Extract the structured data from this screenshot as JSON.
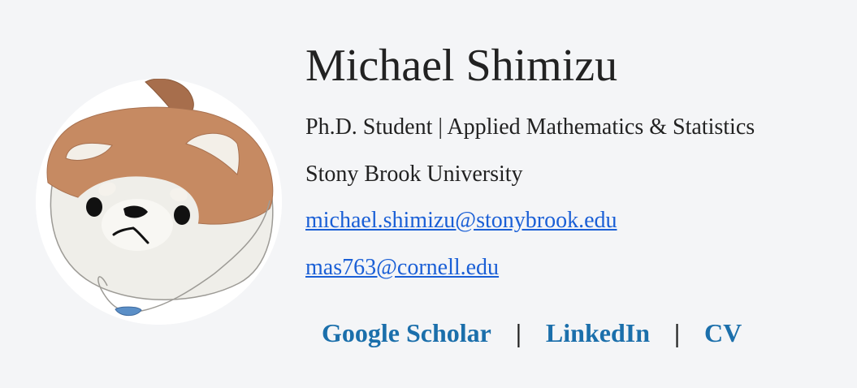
{
  "profile": {
    "name": "Michael Shimizu",
    "title": "Ph.D. Student | Applied Mathematics & Statistics",
    "university": "Stony Brook University",
    "emails": [
      "michael.shimizu@stonybrook.edu",
      "mas763@cornell.edu"
    ]
  },
  "links": {
    "items": [
      "Google Scholar",
      "LinkedIn",
      "CV"
    ],
    "separator": "|"
  },
  "avatar": {
    "icon": "shiba-plush-icon"
  },
  "colors": {
    "background": "#f4f5f7",
    "text": "#222222",
    "email_link": "#1a5fd6",
    "nav_link": "#1b6fab",
    "fur_brown": "#c68a62",
    "fur_cream": "#efeee9"
  }
}
